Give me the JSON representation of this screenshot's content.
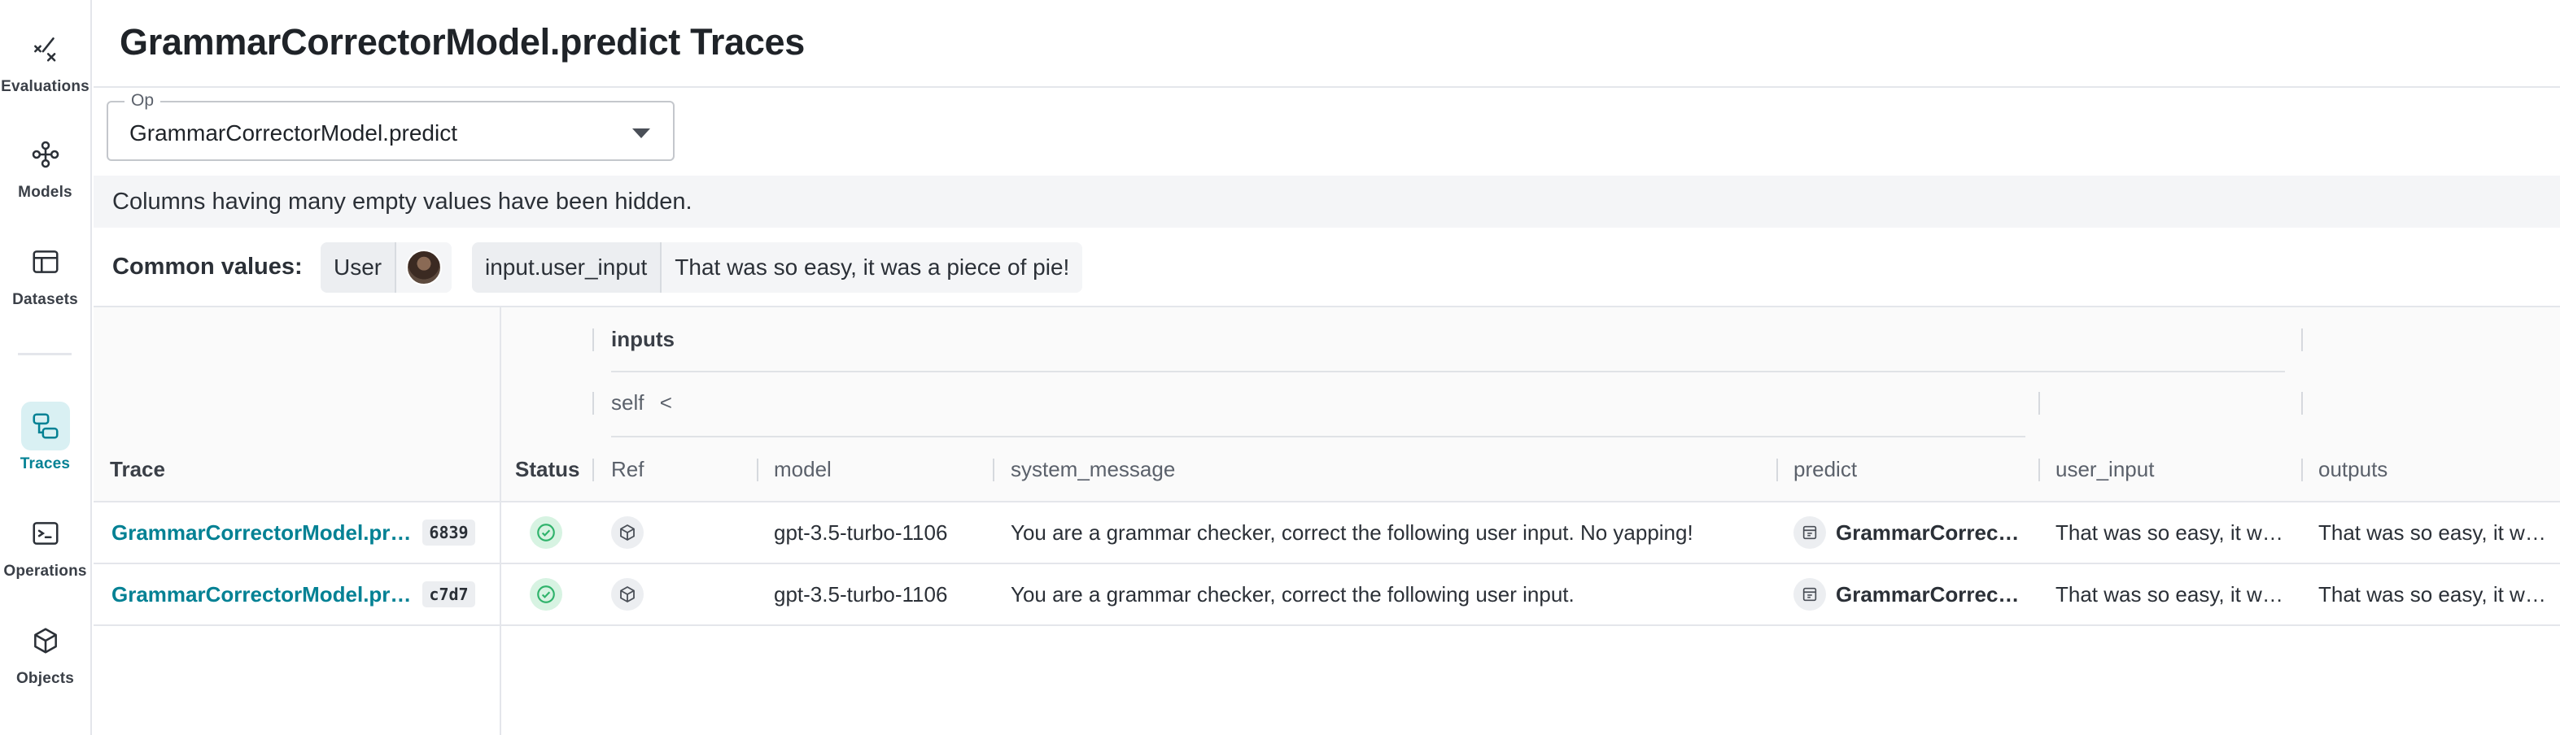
{
  "sidebar": {
    "items": [
      {
        "label": "Evaluations",
        "icon": "evaluations-icon"
      },
      {
        "label": "Models",
        "icon": "models-icon"
      },
      {
        "label": "Datasets",
        "icon": "datasets-icon"
      },
      {
        "label": "Traces",
        "icon": "traces-icon",
        "active": true
      },
      {
        "label": "Operations",
        "icon": "operations-icon"
      },
      {
        "label": "Objects",
        "icon": "objects-icon"
      }
    ]
  },
  "header": {
    "title": "GrammarCorrectorModel.predict Traces"
  },
  "op_filter": {
    "legend": "Op",
    "value": "GrammarCorrectorModel.predict"
  },
  "banner": {
    "text": "Columns having many empty values have been hidden."
  },
  "common_values": {
    "label": "Common values:",
    "chips": [
      {
        "key": "User",
        "value": ""
      },
      {
        "key": "input.user_input",
        "value": "That was so easy, it was a piece of pie!"
      }
    ]
  },
  "table": {
    "group_inputs": "inputs",
    "group_self": "self",
    "self_chevron": "<",
    "columns": {
      "trace": "Trace",
      "status": "Status",
      "ref": "Ref",
      "model": "model",
      "system_message": "system_message",
      "predict": "predict",
      "user_input": "user_input",
      "outputs": "outputs"
    },
    "rows": [
      {
        "trace": "GrammarCorrectorModel.pr…",
        "id": "6839",
        "model": "gpt-3.5-turbo-1106",
        "system_message": "You are a grammar checker, correct the following user input. No yapping!",
        "predict": "GrammarCorrec…",
        "user_input": "That was so easy, it w…",
        "outputs": "That was so easy, it w…"
      },
      {
        "trace": "GrammarCorrectorModel.pr…",
        "id": "c7d7",
        "model": "gpt-3.5-turbo-1106",
        "system_message": "You are a grammar checker, correct the following user input.",
        "predict": "GrammarCorrec…",
        "user_input": "That was so easy, it w…",
        "outputs": "That was so easy, it w…"
      }
    ]
  },
  "colors": {
    "accent": "#038194",
    "active_bg": "#d9f0f3",
    "success": "#2fb36b"
  }
}
